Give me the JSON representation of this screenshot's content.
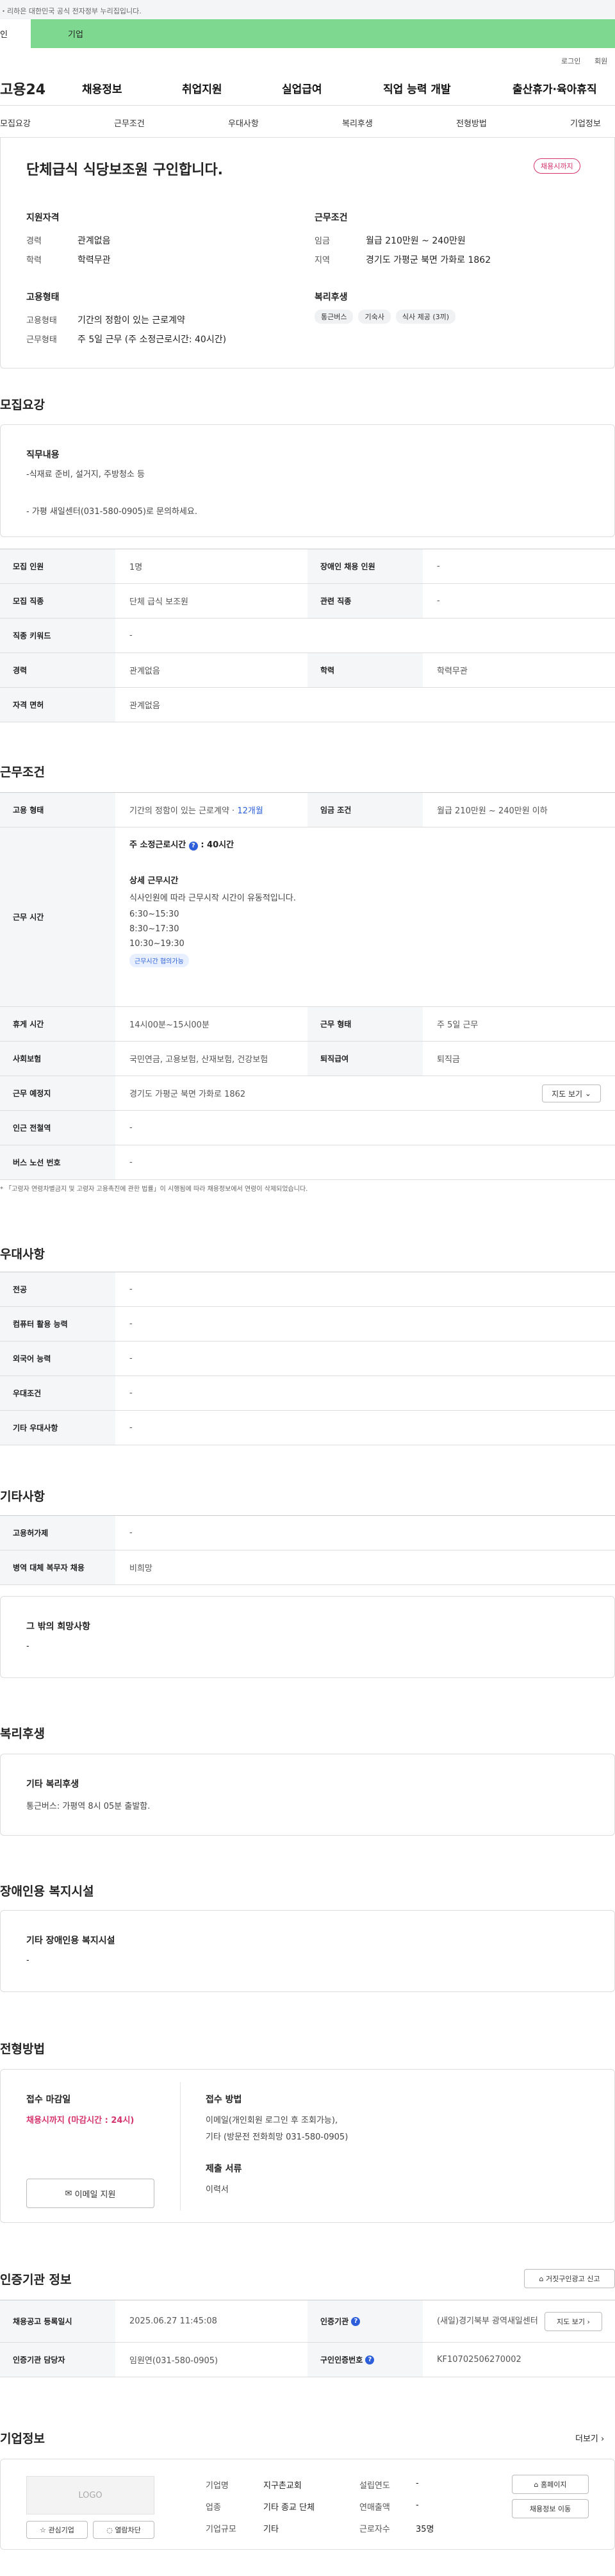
{
  "gov_banner": "・리하은 대한민국 공식 전자정부 누리집입니다.",
  "audience_tabs": [
    "인",
    "기업"
  ],
  "util": {
    "login": "로그인",
    "signup": "회원"
  },
  "gnb": {
    "logo": "고용24",
    "items": [
      "채용정보",
      "취업지원",
      "실업급여",
      "직업 능력 개발",
      "출산휴가·육아휴직"
    ]
  },
  "lnb": [
    "모집요강",
    "근무조건",
    "우대사항",
    "복리후생",
    "전형방법",
    "기업정보"
  ],
  "summary": {
    "title": "단체급식 식당보조원 구인합니다.",
    "status": "채용시까지",
    "qual_title": "지원자격",
    "career_label": "경력",
    "career": "관계없음",
    "edu_label": "학력",
    "edu": "학력무관",
    "cond_title": "근무조건",
    "wage_label": "임금",
    "wage": "월급 210만원 ~ 240만원",
    "region_label": "지역",
    "region": "경기도 가평군 북면 가화로 1862",
    "emp_title": "고용형태",
    "emp_label": "고용형태",
    "emp": "기간의 정함이 있는 근로계약",
    "work_label": "근무형태",
    "work": "주 5일 근무 (주 소정근로시간: 40시간)",
    "welfare_title": "복리후생",
    "welfare_badges": [
      "통근버스",
      "기숙사",
      "식사 제공 (3끼)"
    ]
  },
  "recruit": {
    "heading": "모집요강",
    "duty_title": "직무내용",
    "duty_line1": "-식재료 준비, 설거지, 주방청소 등",
    "duty_line2": "- 가평 새일센터(031-580-0905)로 문의하세요.",
    "rows": [
      {
        "th": "모집 인원",
        "td": "1명",
        "th2": "장애인 채용 인원",
        "td2": "-"
      },
      {
        "th": "모집 직종",
        "td": "단체 급식 보조원",
        "th2": "관련 직종",
        "td2": "-"
      },
      {
        "th": "직종 키워드",
        "td": "-"
      },
      {
        "th": "경력",
        "td": "관계없음",
        "th2": "학력",
        "td2": "학력무관"
      },
      {
        "th": "자격 면허",
        "td": "관계없음"
      }
    ]
  },
  "workcond": {
    "heading": "근무조건",
    "emp_th": "고용 형태",
    "emp_td": "기간의 정함이 있는 근로계약 · ",
    "emp_period": "12개월",
    "wage_th": "임금 조건",
    "wage_td": "월급 210만원 ~ 240만원 이하",
    "hours_th": "근무 시간",
    "hours_weekly": "주 소정근로시간",
    "hours_weekly_val": ": 40시간",
    "hours_detail_title": "상세 근무시간",
    "hours_detail_desc": "식사인원에 따라 근무시작 시간이 유동적입니다.",
    "hours_list": [
      "6:30~15:30",
      "8:30~17:30",
      "10:30~19:30"
    ],
    "hours_tag": "근무시간 협의가능",
    "rest_th": "휴게 시간",
    "rest_td": "14시00분~15시00분",
    "worktype_th": "근무 형태",
    "worktype_td": "주 5일 근무",
    "ins_th": "사회보험",
    "ins_td": "국민연금, 고용보험, 산재보험, 건강보험",
    "sev_th": "퇴직급여",
    "sev_td": "퇴직금",
    "loc_th": "근무 예정지",
    "loc_td": "경기도 가평군 북면 가화로 1862",
    "map_btn": "지도 보기",
    "station_th": "인근 전철역",
    "station_td": "-",
    "bus_th": "버스 노선 번호",
    "bus_td": "-",
    "note": "* 「고령자 연령차별금지 및 고령자 고용촉진에 관한 법률」이 시행됨에 따라 채용정보에서 연령이 삭제되었습니다."
  },
  "pref": {
    "heading": "우대사항",
    "rows": [
      {
        "th": "전공",
        "td": "-"
      },
      {
        "th": "컴퓨터 활용 능력",
        "td": "-"
      },
      {
        "th": "외국어 능력",
        "td": "-"
      },
      {
        "th": "우대조건",
        "td": "-"
      },
      {
        "th": "기타 우대사항",
        "td": "-"
      }
    ]
  },
  "etc": {
    "heading": "기타사항",
    "rows": [
      {
        "th": "고용허가제",
        "td": "-"
      },
      {
        "th": "병역 대체 복무자 채용",
        "td": "비희망"
      }
    ],
    "other_title": "그 밖의 희망사항",
    "other_val": "-"
  },
  "welfare": {
    "heading": "복리후생",
    "title": "기타 복리후생",
    "desc": "통근버스: 가평역 8시 05분 출발함."
  },
  "disab": {
    "heading": "장애인용 복지시설",
    "title": "기타 장애인용 복지시설",
    "val": "-"
  },
  "apply": {
    "heading": "전형방법",
    "deadline_title": "접수 마감일",
    "deadline": "채용시까지 (마감시간 : 24시)",
    "email_btn": "이메일 지원",
    "method_title": "접수 방법",
    "method_line1": "이메일(개인회원 로그인 후 조회가능),",
    "method_line2": "기타 (방문전 전화희망 031-580-0905)",
    "docs_title": "제출 서류",
    "docs": "이력서"
  },
  "agency": {
    "heading": "인증기관 정보",
    "report_btn": "거짓구인광고 신고",
    "reg_th": "채용공고 등록일시",
    "reg_td": "2025.06.27 11:45:08",
    "org_th": "인증기관",
    "org_td": "(새일)경기북부 광역새일센터",
    "map_btn": "지도 보기",
    "mgr_th": "인증기관 담당자",
    "mgr_td": "임원연(031-580-0905)",
    "id_th": "구인인증번호",
    "id_td": "KF10702506270002"
  },
  "company": {
    "heading": "기업정보",
    "more": "더보기",
    "logo": "LOGO",
    "fav_btn": "관심기업",
    "block_btn": "열람차단",
    "name_label": "기업명",
    "name": "지구촌교회",
    "industry_label": "업종",
    "industry": "기타 종교 단체",
    "size_label": "기업규모",
    "size": "기타",
    "founded_label": "설립연도",
    "founded": "-",
    "revenue_label": "연매출액",
    "revenue": "-",
    "employees_label": "근로자수",
    "employees": "35명",
    "home_btn": "홈페이지",
    "jobs_btn": "채용정보 이동"
  },
  "colors": {
    "accent": "#2c5fd9",
    "status": "#d6336c",
    "bar": "#7fd890"
  }
}
